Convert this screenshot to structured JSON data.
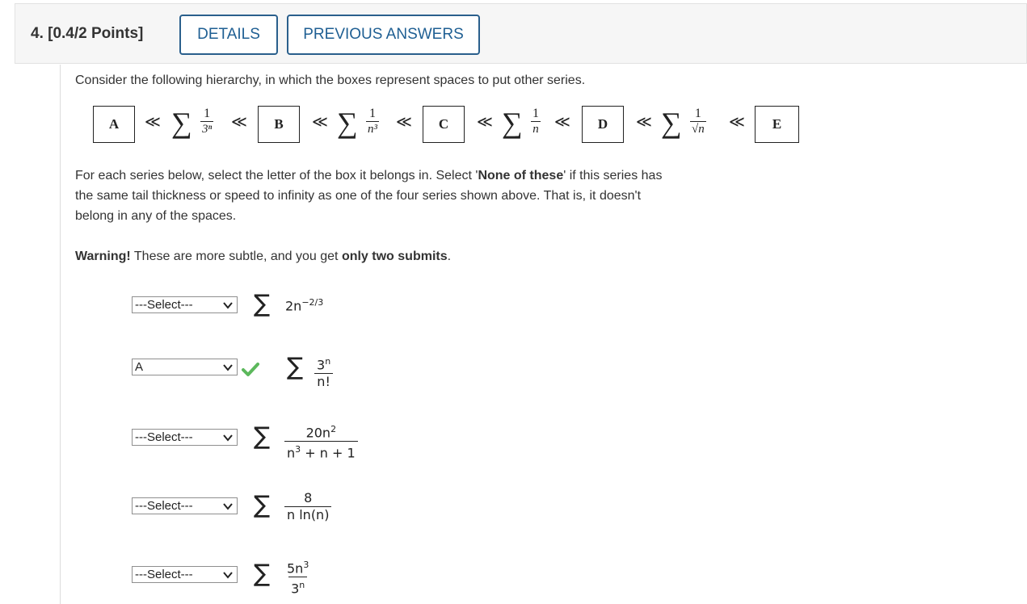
{
  "header": {
    "question_label": "4. [0.4/2 Points]",
    "details_label": "DETAILS",
    "previous_answers_label": "PREVIOUS ANSWERS"
  },
  "intro": "Consider the following hierarchy, in which the boxes represent spaces to put other series.",
  "hierarchy": {
    "boxes": [
      "A",
      "B",
      "C",
      "D",
      "E"
    ],
    "relation": "≪",
    "sigma": "∑",
    "series": [
      {
        "num": "1",
        "den": "3ⁿ"
      },
      {
        "num": "1",
        "den": "n³"
      },
      {
        "num": "1",
        "den": "n"
      },
      {
        "num": "1",
        "den": "√n"
      }
    ]
  },
  "instructions": {
    "line1_pre": "For each series below, select the letter of the box it belongs in. Select '",
    "line1_bold": "None of these",
    "line1_post": "' if this series has",
    "line2": "the same tail thickness or speed to infinity as one of the four series shown above. That is, it doesn't",
    "line3": "belong in any of the spaces."
  },
  "warning": {
    "bold": "Warning!",
    "mid": " These are more subtle, and you get ",
    "bold2": "only two submits",
    "end": "."
  },
  "items": [
    {
      "selected": "---Select---",
      "sigma": "∑",
      "base": "2n",
      "exp": "−2/3"
    },
    {
      "selected": "A",
      "correct": true,
      "sigma": "∑",
      "num": "3",
      "num_exp": "n",
      "den": "n!"
    },
    {
      "selected": "---Select---",
      "sigma": "∑",
      "num": "20n",
      "num_exp": "2",
      "den_a": "n",
      "den_a_exp": "3",
      "den_b": " + n + 1"
    },
    {
      "selected": "---Select---",
      "sigma": "∑",
      "num": "8",
      "den": "n ln(n)"
    },
    {
      "selected": "---Select---",
      "sigma": "∑",
      "num": "5n",
      "num_exp": "3",
      "den": "3",
      "den_exp": "n"
    }
  ],
  "colors": {
    "accent": "#1f5f93",
    "check": "#5cb85c"
  }
}
